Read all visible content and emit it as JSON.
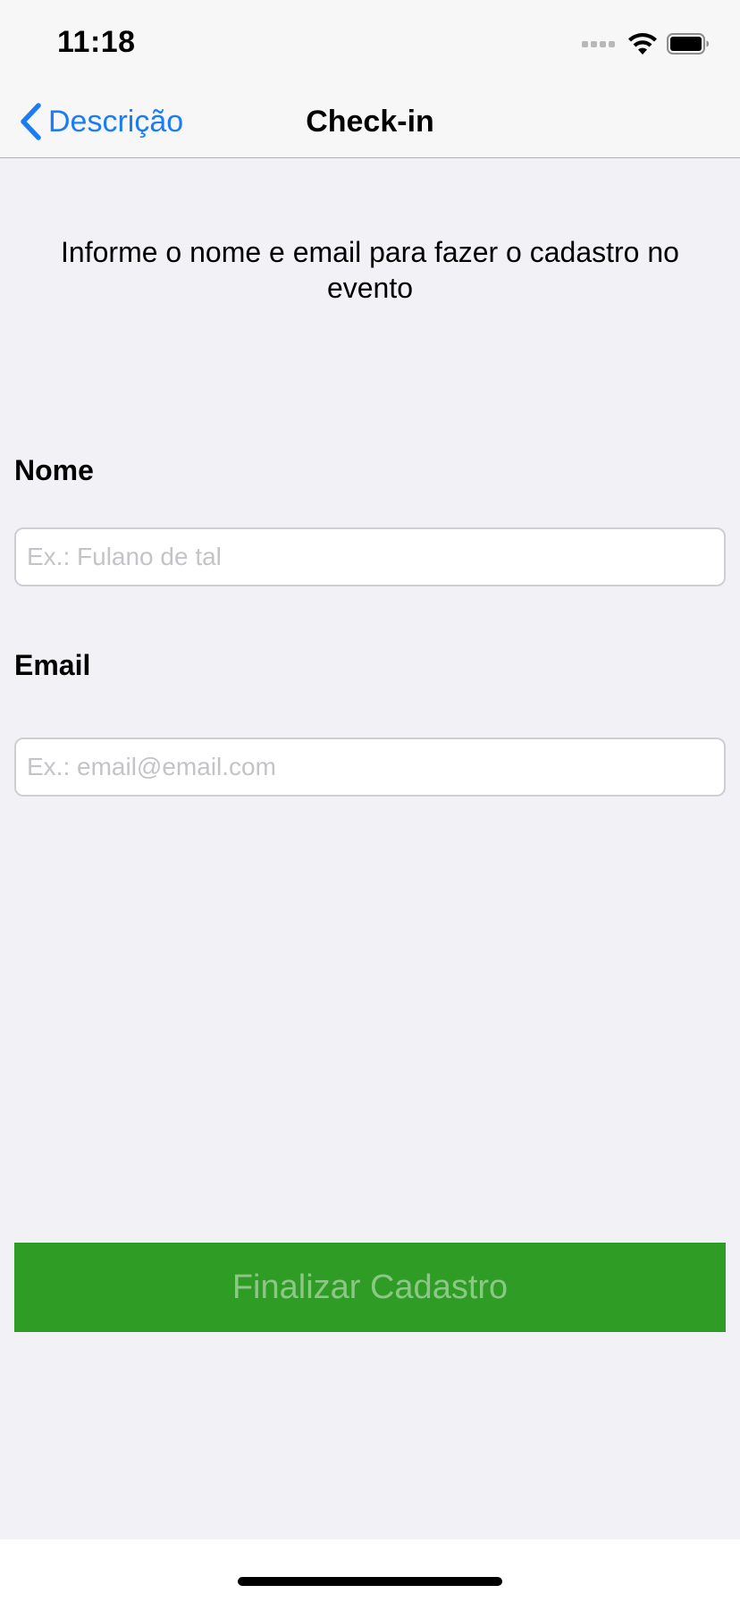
{
  "status_bar": {
    "time": "11:18",
    "icons": [
      "signal-icon",
      "wifi-icon",
      "battery-icon"
    ]
  },
  "nav": {
    "back_label": "Descrição",
    "title": "Check-in"
  },
  "instructions": "Informe o nome e email para fazer o cadastro no evento",
  "form": {
    "name_label": "Nome",
    "name_placeholder": "Ex.: Fulano de tal",
    "name_value": "",
    "email_label": "Email",
    "email_placeholder": "Ex.: email@email.com",
    "email_value": ""
  },
  "submit_label": "Finalizar Cadastro",
  "colors": {
    "accent": "#1a7df5",
    "button_bg": "#2f9c25",
    "button_text": "#8cc786",
    "background": "#f1f1f6"
  }
}
